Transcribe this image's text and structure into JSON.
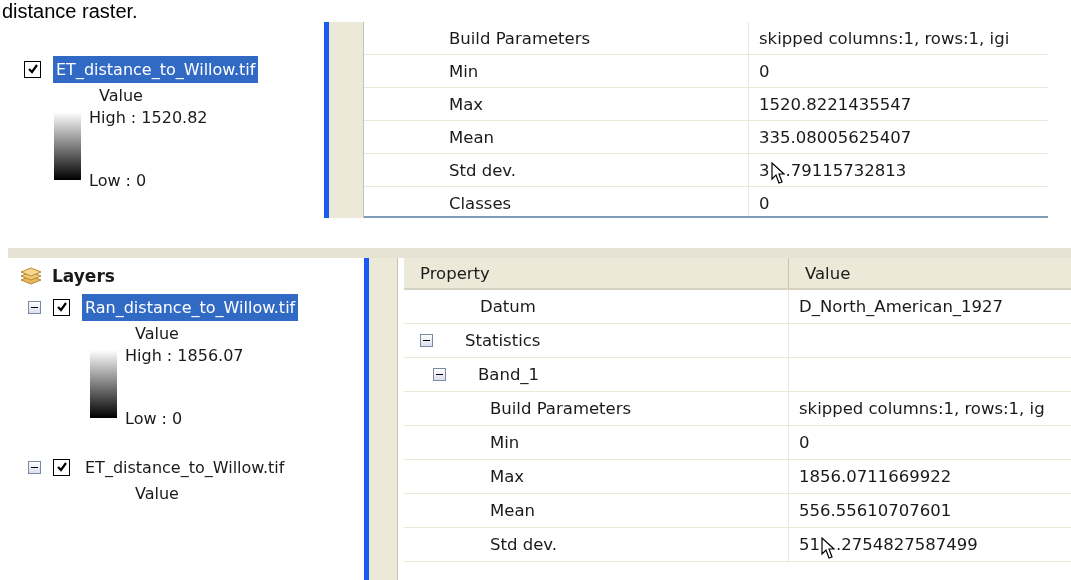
{
  "caption": "distance raster.",
  "panels": [
    {
      "toc": {
        "layers": [
          {
            "name": "ET_distance_to_Willow.tif",
            "checked": true,
            "selected": true,
            "legend": {
              "heading": "Value",
              "high": "High : 1520.82",
              "low": "Low : 0"
            }
          }
        ]
      },
      "properties": {
        "rows": [
          {
            "property": "Build Parameters",
            "value": "skipped columns:1, rows:1, igi"
          },
          {
            "property": "Min",
            "value": "0"
          },
          {
            "property": "Max",
            "value": "1520.8221435547"
          },
          {
            "property": "Mean",
            "value": "335.08005625407"
          },
          {
            "property": "Std dev.",
            "value_parts": [
              "3",
              ".79115732813"
            ]
          },
          {
            "property": "Classes",
            "value": "0"
          }
        ]
      }
    },
    {
      "toc": {
        "title": "Layers",
        "layers": [
          {
            "name": "Ran_distance_to_Willow.tif",
            "expanded": true,
            "checked": true,
            "selected": true,
            "legend": {
              "heading": "Value",
              "high": "High : 1856.07",
              "low": "Low : 0"
            }
          },
          {
            "name": "ET_distance_to_Willow.tif",
            "expanded": true,
            "checked": true,
            "selected": false,
            "legend": {
              "heading": "Value"
            }
          }
        ]
      },
      "properties": {
        "columns": [
          "Property",
          "Value"
        ],
        "rows": [
          {
            "property": "Datum",
            "value": "D_North_American_1927"
          },
          {
            "property": "Statistics",
            "expanded": true,
            "children": [
              {
                "property": "Band_1",
                "expanded": true,
                "children": [
                  {
                    "property": "Build Parameters",
                    "value": "skipped columns:1, rows:1, ig"
                  },
                  {
                    "property": "Min",
                    "value": "0"
                  },
                  {
                    "property": "Max",
                    "value": "1856.0711669922"
                  },
                  {
                    "property": "Mean",
                    "value": "556.55610707601"
                  },
                  {
                    "property": "Std dev.",
                    "value_parts": [
                      "51",
                      ".2754827587499"
                    ]
                  }
                ]
              }
            ]
          }
        ]
      }
    }
  ]
}
